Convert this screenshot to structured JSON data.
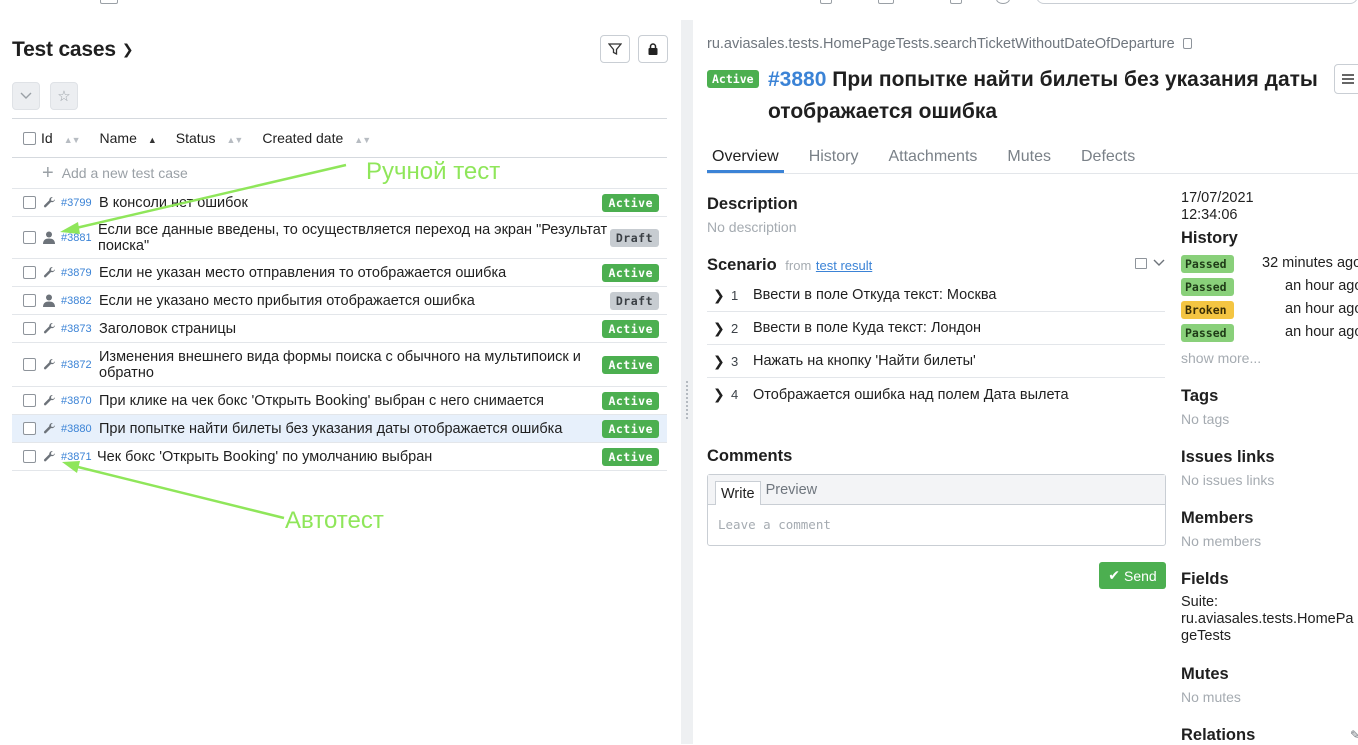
{
  "left": {
    "title": "Test cases",
    "columns": [
      "Id",
      "Name",
      "Status",
      "Created date"
    ],
    "add_label": "Add a new test case",
    "rows": [
      {
        "id": "#3799",
        "name": "В консоли нет ошибок",
        "status": "Active",
        "type": "auto"
      },
      {
        "id": "#3881",
        "name": "Если все данные введены, то осуществляется переход на экран \"Результат поиска\"",
        "status": "Draft",
        "type": "manual"
      },
      {
        "id": "#3879",
        "name": "Если не указан место отправления то отображается ошибка",
        "status": "Active",
        "type": "auto"
      },
      {
        "id": "#3882",
        "name": "Если не указано место прибытия отображается ошибка",
        "status": "Draft",
        "type": "manual"
      },
      {
        "id": "#3873",
        "name": "Заголовок страницы",
        "status": "Active",
        "type": "auto"
      },
      {
        "id": "#3872",
        "name": "Изменения внешнего вида формы поиска с обычного на мультипоиск и обратно",
        "status": "Active",
        "type": "auto"
      },
      {
        "id": "#3870",
        "name": "При клике на чек бокс 'Открыть Booking' выбран с него снимается",
        "status": "Active",
        "type": "auto"
      },
      {
        "id": "#3880",
        "name": "При попытке найти билеты без указания даты отображается ошибка",
        "status": "Active",
        "type": "auto",
        "selected": true
      },
      {
        "id": "#3871",
        "name": "Чек бокс 'Открыть Booking' по умолчанию выбран",
        "status": "Active",
        "type": "auto"
      }
    ],
    "annotations": {
      "manual": "Ручной тест",
      "auto": "Автотест"
    }
  },
  "detail": {
    "path": "ru.aviasales.tests.HomePageTests.searchTicketWithoutDateOfDeparture",
    "status": "Active",
    "id": "#3880",
    "title": "При попытке найти билеты без указания даты отображается ошибка",
    "tabs": [
      "Overview",
      "History",
      "Attachments",
      "Mutes",
      "Defects"
    ],
    "description_heading": "Description",
    "description": "No description",
    "scenario_heading": "Scenario",
    "scenario_from": "from",
    "scenario_link": "test result",
    "steps": [
      {
        "n": "1",
        "text": "Ввести в поле Откуда текст: Москва"
      },
      {
        "n": "2",
        "text": "Ввести в поле Куда текст: Лондон"
      },
      {
        "n": "3",
        "text": "Нажать на кнопку 'Найти билеты'"
      },
      {
        "n": "4",
        "text": "Отображается ошибка над полем Дата вылета"
      }
    ],
    "comments_heading": "Comments",
    "write_tab": "Write",
    "preview_tab": "Preview",
    "comment_placeholder": "Leave a comment",
    "send_label": "Send"
  },
  "side": {
    "date": "17/07/2021",
    "time": "12:34:06",
    "history_heading": "History",
    "history": [
      {
        "status": "Passed",
        "when": "32 minutes ago"
      },
      {
        "status": "Passed",
        "when": "an hour ago"
      },
      {
        "status": "Broken",
        "when": "an hour ago"
      },
      {
        "status": "Passed",
        "when": "an hour ago"
      }
    ],
    "show_more": "show more...",
    "tags_heading": "Tags",
    "tags_empty": "No tags",
    "issues_heading": "Issues links",
    "issues_empty": "No issues links",
    "members_heading": "Members",
    "members_empty": "No members",
    "fields_heading": "Fields",
    "suite_label": "Suite:",
    "suite_line1": "ru.aviasales.tests.HomePa",
    "suite_line2": "geTests",
    "mutes_heading": "Mutes",
    "mutes_empty": "No mutes",
    "relations_heading": "Relations"
  },
  "colors": {
    "accent": "#3b83d6",
    "active": "#4caf50",
    "annotation": "#8fe65a",
    "broken": "#f4c542"
  }
}
